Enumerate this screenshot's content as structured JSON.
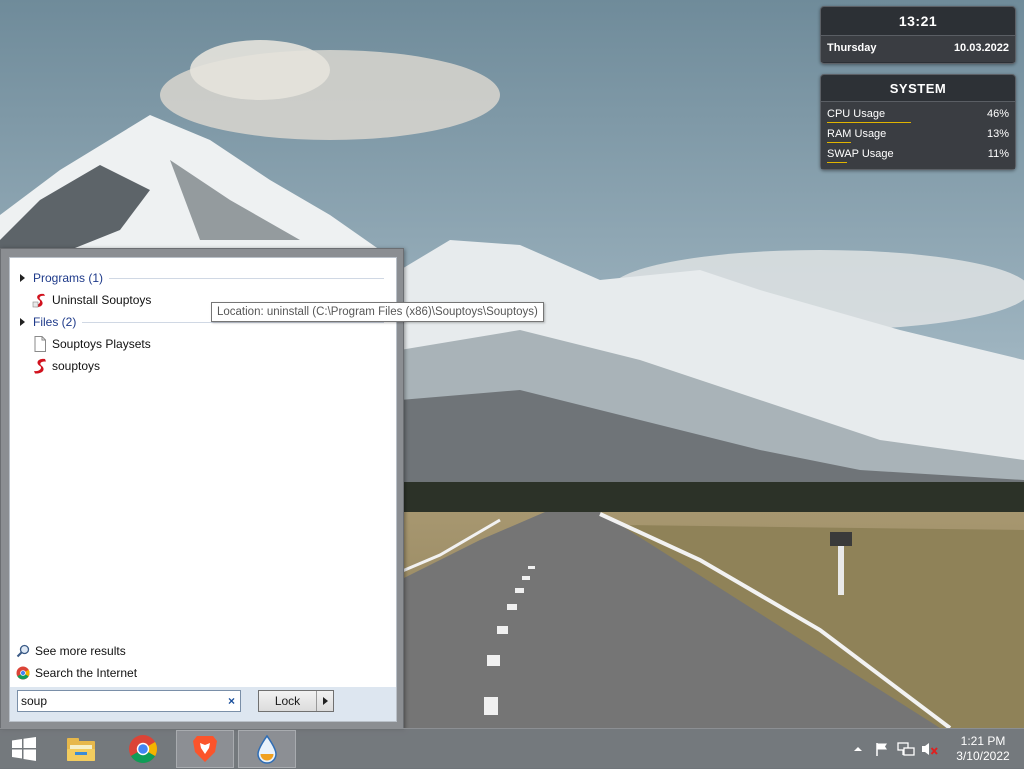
{
  "clock_widget": {
    "time": "13:21",
    "day": "Thursday",
    "date": "10.03.2022"
  },
  "system_widget": {
    "title": "SYSTEM",
    "rows": [
      {
        "label": "CPU Usage",
        "value": "46%",
        "level": 0.46
      },
      {
        "label": "RAM Usage",
        "value": "13%",
        "level": 0.13
      },
      {
        "label": "SWAP Usage",
        "value": "11%",
        "level": 0.11
      }
    ]
  },
  "search_results": {
    "groups": [
      {
        "label": "Programs (1)",
        "items": [
          {
            "label": "Uninstall Souptoys",
            "icon": "souptoys-icon"
          }
        ]
      },
      {
        "label": "Files (2)",
        "items": [
          {
            "label": "Souptoys Playsets",
            "icon": "document-icon"
          },
          {
            "label": "souptoys",
            "icon": "souptoys-icon"
          }
        ]
      }
    ],
    "see_more": "See more results",
    "search_internet": "Search the Internet",
    "tooltip": "Location: uninstall (C:\\Program Files (x86)\\Souptoys\\Souptoys)"
  },
  "search_box": {
    "value": "soup",
    "clear_glyph": "×"
  },
  "lock_button": {
    "label": "Lock"
  },
  "taskbar": {
    "apps": [
      {
        "name": "file-explorer-icon",
        "active": false
      },
      {
        "name": "chrome-icon",
        "active": false
      },
      {
        "name": "brave-icon",
        "active": true
      },
      {
        "name": "droplet-app-icon",
        "active": true
      }
    ],
    "tray": {
      "time": "1:21 PM",
      "date": "3/10/2022"
    }
  },
  "colors": {
    "accent_bar": "#e0b400",
    "widget_bg": "#26282c",
    "group_header": "#1e3a8a"
  }
}
